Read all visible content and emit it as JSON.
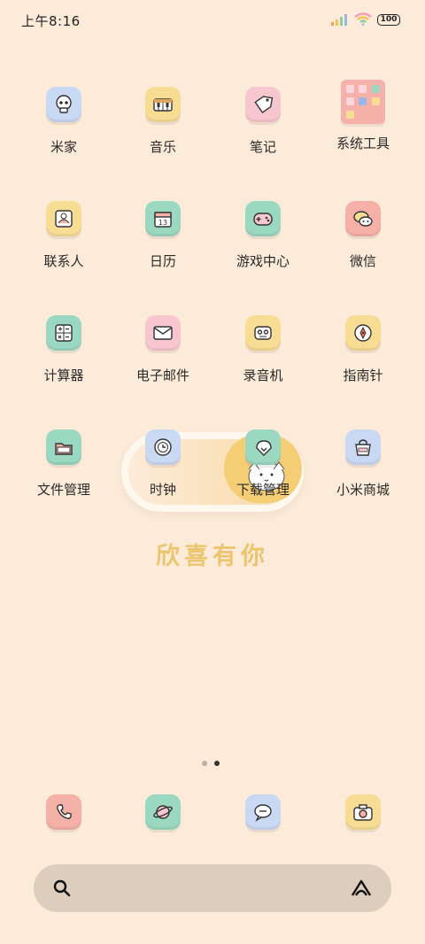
{
  "status_bar": {
    "time": "上午8:16",
    "battery": "100"
  },
  "apps": [
    {
      "label": "米家",
      "icon": "skull-icon",
      "color": "#c9d9f4"
    },
    {
      "label": "音乐",
      "icon": "piano-icon",
      "color": "#f7dc94"
    },
    {
      "label": "笔记",
      "icon": "tag-icon",
      "color": "#f8c6cf"
    },
    {
      "label": "系统工具",
      "icon": "folder-icon",
      "color": "#f7b1ab"
    },
    {
      "label": "联系人",
      "icon": "contact-card-icon",
      "color": "#f7dc94"
    },
    {
      "label": "日历",
      "icon": "calendar-icon",
      "color": "#9ad8c2",
      "day": "13"
    },
    {
      "label": "游戏中心",
      "icon": "gamepad-icon",
      "color": "#f5b1a8"
    },
    {
      "label": "微信",
      "icon": "chat-bubbles-icon",
      "color": "#f5b1a8"
    },
    {
      "label": "计算器",
      "icon": "calculator-icon",
      "color": "#9ad8c2"
    },
    {
      "label": "电子邮件",
      "icon": "mail-icon",
      "color": "#f8c6cf"
    },
    {
      "label": "录音机",
      "icon": "recorder-icon",
      "color": "#f7dc94"
    },
    {
      "label": "指南针",
      "icon": "compass-icon",
      "color": "#f7dc94"
    },
    {
      "label": "文件管理",
      "icon": "file-box-icon",
      "color": "#9ad8c2"
    },
    {
      "label": "时钟",
      "icon": "clock-icon",
      "color": "#c9d9f4"
    },
    {
      "label": "下载管理",
      "icon": "download-icon",
      "color": "#9ad8c2"
    },
    {
      "label": "小米商城",
      "icon": "shop-bag-icon",
      "color": "#c9d9f4"
    }
  ],
  "slogan": "欣喜有你",
  "pages": {
    "total": 2,
    "current": 2
  },
  "dock": [
    {
      "icon": "phone-icon",
      "color": "#f5b1a8"
    },
    {
      "icon": "browser-planet-icon",
      "color": "#9ad8c2"
    },
    {
      "icon": "message-icon",
      "color": "#c9d9f4"
    },
    {
      "icon": "camera-icon",
      "color": "#f7dc94"
    }
  ],
  "search_bar": {
    "left_icon": "search-icon",
    "right_icon": "assistant-icon"
  }
}
